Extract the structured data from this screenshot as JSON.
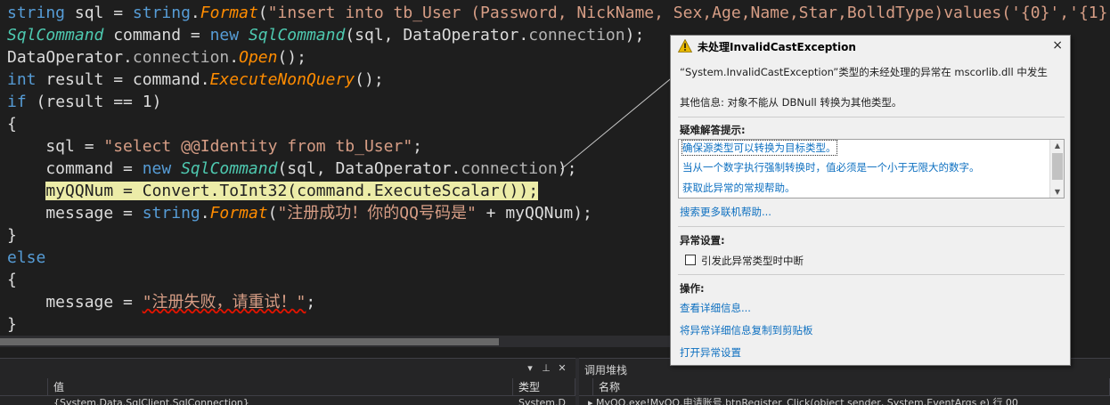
{
  "editor": {
    "lines": [
      [
        [
          "kw",
          "string"
        ],
        [
          "p",
          " sql = "
        ],
        [
          "kw",
          "string"
        ],
        [
          "p",
          "."
        ],
        [
          "me",
          "Format"
        ],
        [
          "p",
          "("
        ],
        [
          "st",
          "\"insert into tb_User (Password, NickName, Sex,Age,Name,Star,BolldType)values('{0}','{1}"
        ]
      ],
      [
        [
          "ty",
          "SqlCommand"
        ],
        [
          "p",
          " command = "
        ],
        [
          "kw",
          "new"
        ],
        [
          "p",
          " "
        ],
        [
          "ty",
          "SqlCommand"
        ],
        [
          "p",
          "(sql, DataOperator."
        ],
        [
          "fi",
          "connection"
        ],
        [
          "p",
          ");"
        ]
      ],
      [
        [
          "p",
          "DataOperator."
        ],
        [
          "fi",
          "connection"
        ],
        [
          "p",
          "."
        ],
        [
          "me",
          "Open"
        ],
        [
          "p",
          "();"
        ]
      ],
      [
        [
          "kw",
          "int"
        ],
        [
          "p",
          " result = command."
        ],
        [
          "me",
          "ExecuteNonQuery"
        ],
        [
          "p",
          "();"
        ]
      ],
      [
        [
          "kw",
          "if"
        ],
        [
          "p",
          " (result == 1)"
        ]
      ],
      [
        [
          "p",
          "{"
        ]
      ],
      [
        [
          "p",
          "    sql = "
        ],
        [
          "st",
          "\"select @@Identity from tb_User\""
        ],
        [
          "p",
          ";"
        ]
      ],
      [
        [
          "p",
          "    command = "
        ],
        [
          "kw",
          "new"
        ],
        [
          "p",
          " "
        ],
        [
          "ty",
          "SqlCommand"
        ],
        [
          "p",
          "(sql, DataOperator."
        ],
        [
          "fi",
          "connection"
        ],
        [
          "p",
          ");"
        ]
      ],
      [
        [
          "p",
          "    "
        ],
        [
          "hl",
          "myQQNum = Convert.ToInt32(command.ExecuteScalar());"
        ]
      ],
      [
        [
          "p",
          "    message = "
        ],
        [
          "kw",
          "string"
        ],
        [
          "p",
          "."
        ],
        [
          "me",
          "Format"
        ],
        [
          "p",
          "("
        ],
        [
          "st",
          "\"注册成功！你的QQ号码是\""
        ],
        [
          "p",
          " + myQQNum);"
        ]
      ],
      [
        [
          "p",
          "}"
        ]
      ],
      [
        [
          "kw",
          "else"
        ]
      ],
      [
        [
          "p",
          "{"
        ]
      ],
      [
        [
          "p",
          "    message = "
        ],
        [
          "sq",
          "\"注册失败，请重试！\""
        ],
        [
          "p",
          ";"
        ]
      ],
      [
        [
          "p",
          "}"
        ]
      ]
    ]
  },
  "locals_panel": {
    "pin": "▼ ⊥",
    "columns": {
      "value": "值",
      "type": "类型"
    },
    "row": {
      "value": "{System.Data.SqlClient.SqlConnection}",
      "type": "System.D"
    }
  },
  "callstack_panel": {
    "title": "调用堆栈",
    "columns": {
      "name": "名称"
    },
    "row": {
      "name": "▸ MyQQ.exe!MyQQ.申请账号.btnRegister_Click(object sender, System.EventArgs e) 行 00"
    }
  },
  "exception_popup": {
    "title": "未处理InvalidCastException",
    "close": "×",
    "message": "“System.InvalidCastException”类型的未经处理的异常在 mscorlib.dll 中发生",
    "extra_info": "其他信息: 对象不能从 DBNull 转换为其他类型。",
    "tips_heading": "疑难解答提示:",
    "tips": [
      "确保源类型可以转换为目标类型。",
      "当从一个数字执行强制转换时，值必须是一个小于无限大的数字。",
      "获取此异常的常规帮助。"
    ],
    "search_more": "搜索更多联机帮助...",
    "settings_heading": "异常设置:",
    "break_checkbox_label": "引发此异常类型时中断",
    "break_checked": false,
    "actions_heading": "操作:",
    "actions": [
      "查看详细信息...",
      "将异常详细信息复制到剪贴板",
      "打开异常设置"
    ]
  },
  "colors": {
    "editor_bg": "#1e1e1e",
    "keyword": "#569cd6",
    "type": "#4ec9b0",
    "method": "#ff8c00",
    "string": "#d69d85",
    "highlight": "#ececa8",
    "link": "#0e70c0",
    "warning": "#e8b800"
  }
}
